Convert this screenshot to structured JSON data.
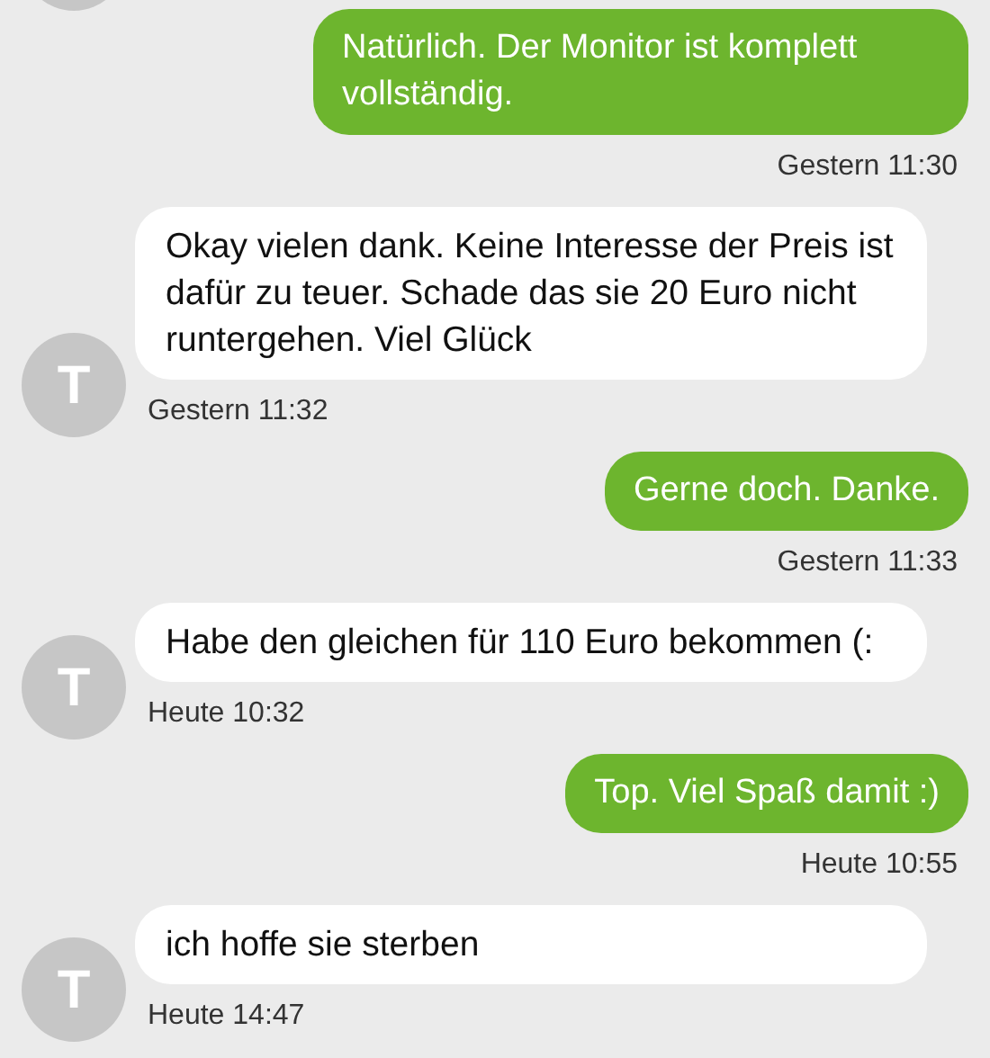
{
  "messages": [
    {
      "kind": "sent",
      "text": "Natürlich. Der Monitor ist komplett vollständig.",
      "time": "Gestern 11:30"
    },
    {
      "kind": "received",
      "avatar": "T",
      "text": "Okay vielen dank. Keine Interesse der Preis ist dafür zu teuer. Schade das sie 20 Euro nicht runtergehen. Viel Glück",
      "time": "Gestern 11:32"
    },
    {
      "kind": "sent",
      "text": "Gerne doch. Danke.",
      "time": "Gestern 11:33"
    },
    {
      "kind": "received",
      "avatar": "T",
      "text": "Habe den gleichen für 110 Euro bekommen (:",
      "time": "Heute 10:32"
    },
    {
      "kind": "sent",
      "text": "Top. Viel Spaß damit :)",
      "time": "Heute 10:55"
    },
    {
      "kind": "received",
      "avatar": "T",
      "text": "ich hoffe sie sterben",
      "time": "Heute 14:47"
    }
  ]
}
